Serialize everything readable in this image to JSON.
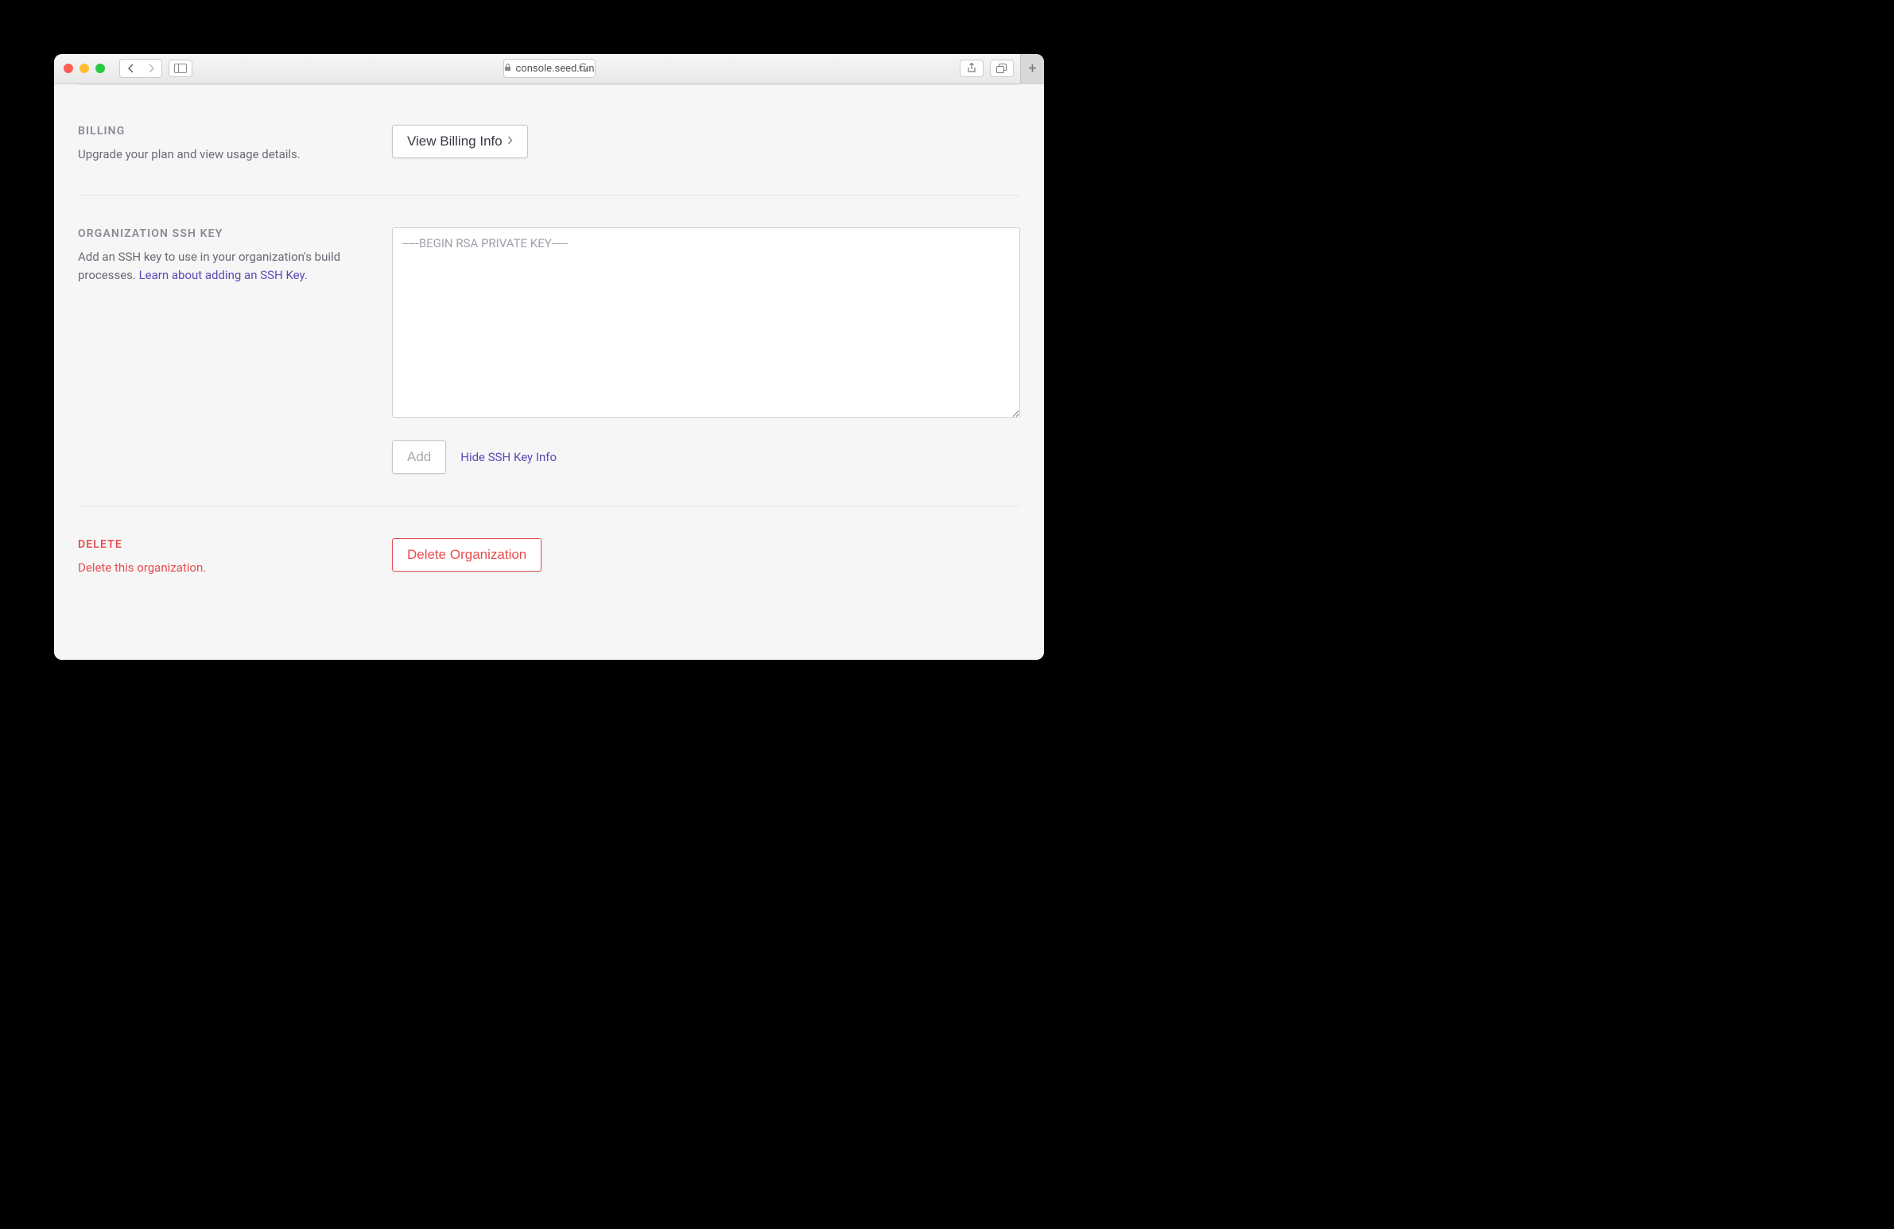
{
  "browser": {
    "url": "console.seed.run"
  },
  "sections": {
    "billing": {
      "heading": "BILLING",
      "desc": "Upgrade your plan and view usage details.",
      "button_label": "View Billing Info"
    },
    "ssh": {
      "heading": "ORGANIZATION SSH KEY",
      "desc_prefix": "Add an SSH key to use in your organization's build processes. ",
      "learn_link": "Learn about adding an SSH Key.",
      "textarea_placeholder": "-----BEGIN RSA PRIVATE KEY-----",
      "add_button": "Add",
      "hide_link": "Hide SSH Key Info"
    },
    "delete": {
      "heading": "DELETE",
      "desc": "Delete this organization.",
      "button_label": "Delete Organization"
    }
  }
}
